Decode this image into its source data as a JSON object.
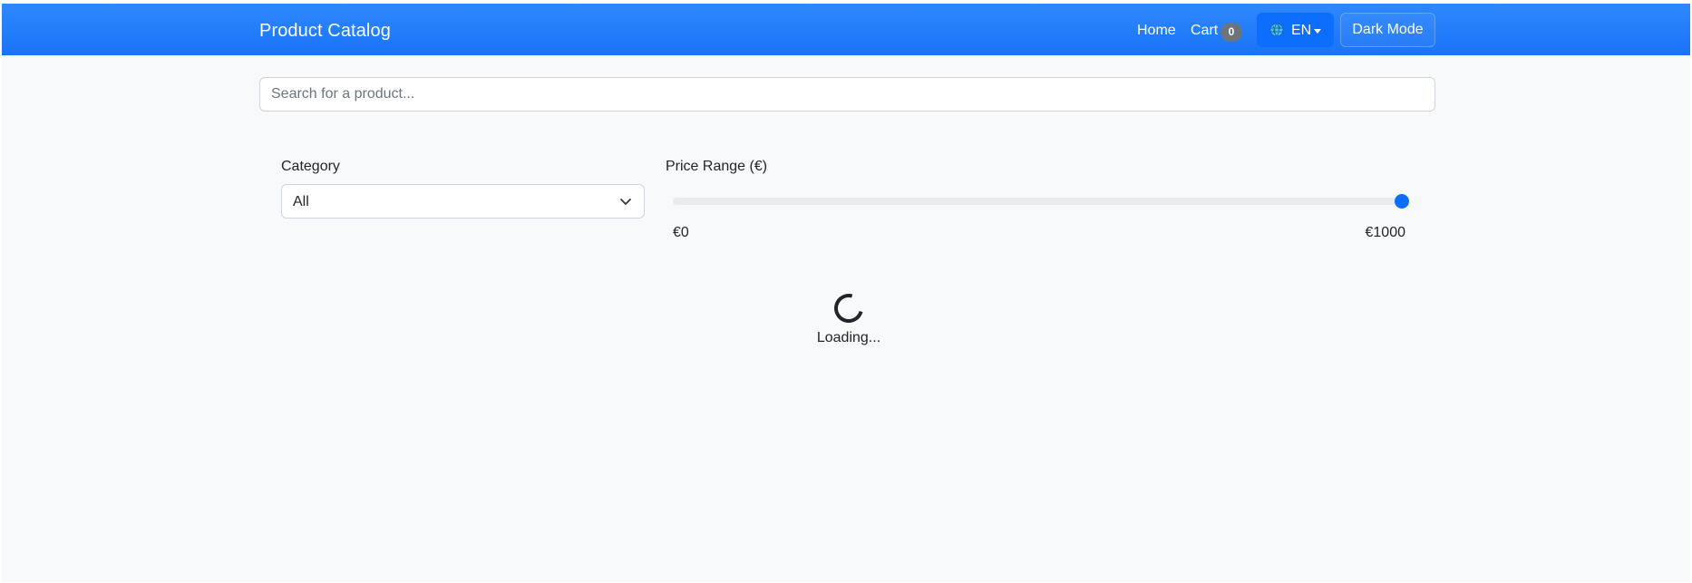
{
  "navbar": {
    "brand": "Product Catalog",
    "home_label": "Home",
    "cart_label": "Cart",
    "cart_count": "0",
    "language_label": "EN",
    "dark_mode_label": "Dark Mode"
  },
  "search": {
    "placeholder": "Search for a product...",
    "value": ""
  },
  "filters": {
    "category_label": "Category",
    "category_selected": "All",
    "price_label": "Price Range (€)",
    "price_min_label": "€0",
    "price_max_label": "€1000",
    "price_min": 0,
    "price_max": 1000,
    "price_value": 1000
  },
  "status": {
    "loading_text": "Loading..."
  },
  "colors": {
    "navbar": "#1a73f8",
    "accent": "#0d6efd",
    "badge": "#6c757d",
    "background": "#f8f9fa"
  },
  "icons": {
    "language": "globe-icon",
    "dropdown": "caret-down-icon",
    "select": "chevron-down-icon",
    "loading": "spinner-icon"
  }
}
